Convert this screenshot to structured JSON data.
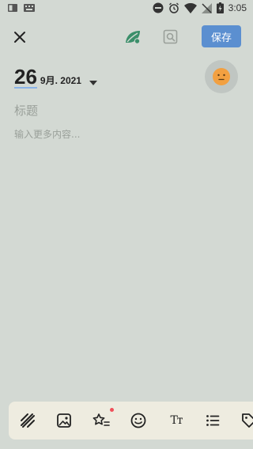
{
  "status_bar": {
    "time": "3:05"
  },
  "toolbar_top": {
    "save_label": "保存"
  },
  "date": {
    "day": "26",
    "month_year": "9月. 2021"
  },
  "editor": {
    "title_placeholder": "标题",
    "body_placeholder": "输入更多内容..."
  },
  "bottom_toolbar": {
    "text_style_label": "Tт",
    "tools": [
      "stripes-icon",
      "image-icon",
      "star-list-icon",
      "smiley-icon",
      "text-style-icon",
      "bullet-list-icon",
      "tag-icon"
    ]
  },
  "colors": {
    "accent": "#5b8fd0",
    "background": "#d3d9d3",
    "toolbar": "#eeece0",
    "leaf": "#3b8f6a",
    "mood": "#f2a041"
  }
}
